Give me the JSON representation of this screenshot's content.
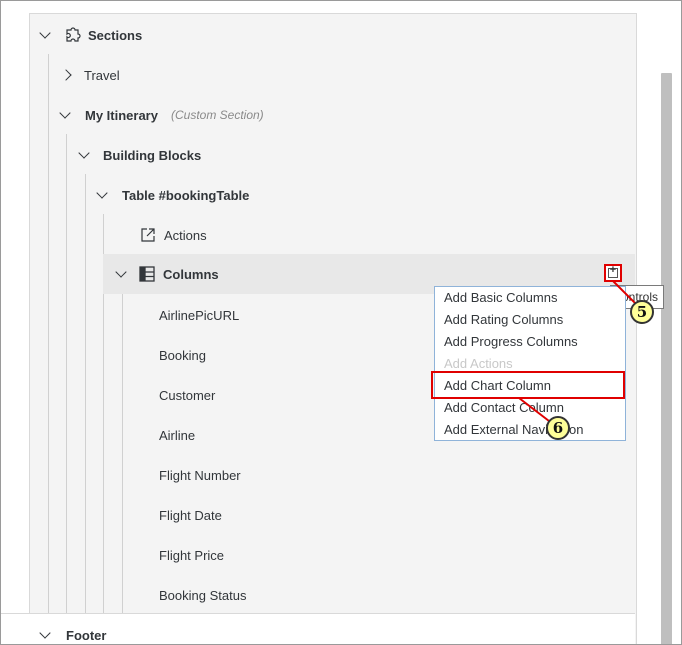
{
  "tree": {
    "sections_label": "Sections",
    "travel_label": "Travel",
    "itinerary_label": "My Itinerary",
    "itinerary_note": "(Custom Section)",
    "building_blocks_label": "Building Blocks",
    "table_label": "Table #bookingTable",
    "actions_label": "Actions",
    "columns_label": "Columns",
    "column_items": [
      "AirlinePicURL",
      "Booking",
      "Customer",
      "Airline",
      "Flight Number",
      "Flight Date",
      "Flight Price",
      "Booking Status"
    ],
    "footer_label": "Footer"
  },
  "menu": {
    "items": [
      {
        "label": "Add Basic Columns",
        "enabled": true
      },
      {
        "label": "Add Rating Columns",
        "enabled": true
      },
      {
        "label": "Add Progress Columns",
        "enabled": true
      },
      {
        "label": "Add Actions",
        "enabled": false
      },
      {
        "label": "Add Chart Column",
        "enabled": true,
        "highlighted": true
      },
      {
        "label": "Add Contact Column",
        "enabled": true
      },
      {
        "label": "Add External Navigation",
        "enabled": true
      }
    ]
  },
  "tooltip": "controls",
  "callouts": {
    "step_5": "5",
    "step_6": "6"
  },
  "colors": {
    "highlight": "#e00000",
    "badge_fill": "#ffff99",
    "menu_border": "#8fb3d9"
  }
}
